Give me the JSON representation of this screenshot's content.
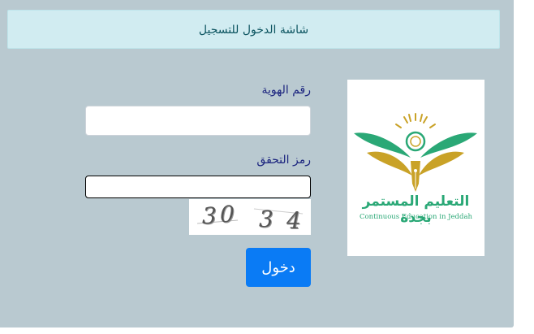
{
  "header": {
    "title": "شاشة الدخول للتسجيل"
  },
  "form": {
    "id_label": "رقم الهوية",
    "id_value": "",
    "captcha_label": "رمز التحقق",
    "captcha_value": "",
    "captcha_chars": [
      "3",
      "0",
      "3",
      "4"
    ],
    "submit_label": "دخول"
  },
  "logo": {
    "arabic_text": "التعليم المستمر بجدة",
    "english_text": "Continuous Education in Jeddah"
  },
  "colors": {
    "panel_bg": "#b9c9d0",
    "header_bg": "#d1ecf1",
    "label_color": "#1a237e",
    "button_bg": "#0a7bf5",
    "logo_green": "#2aa876",
    "logo_gold": "#c9a227"
  }
}
